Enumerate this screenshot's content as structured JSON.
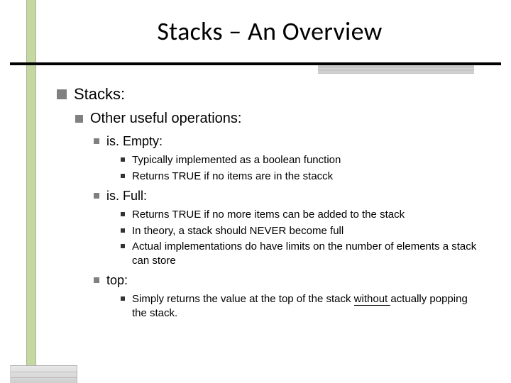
{
  "title": "Stacks – An Overview",
  "l1": {
    "text": "Stacks:"
  },
  "l2": {
    "text": "Other useful operations:"
  },
  "ops": [
    {
      "name": "is. Empty:",
      "points": [
        "Typically implemented as a boolean function",
        "Returns TRUE if no items are in the stacck"
      ]
    },
    {
      "name": "is. Full:",
      "points": [
        "Returns TRUE if no more items can be added to the stack",
        "In theory, a stack should NEVER become full",
        "Actual implementations do have limits on the number of elements a stack can store"
      ]
    },
    {
      "name": "top:",
      "points": []
    }
  ],
  "topline": {
    "prefix": "Simply returns the value at the top of the stack ",
    "underlined": "without ",
    "suffix": "actually popping the stack."
  }
}
